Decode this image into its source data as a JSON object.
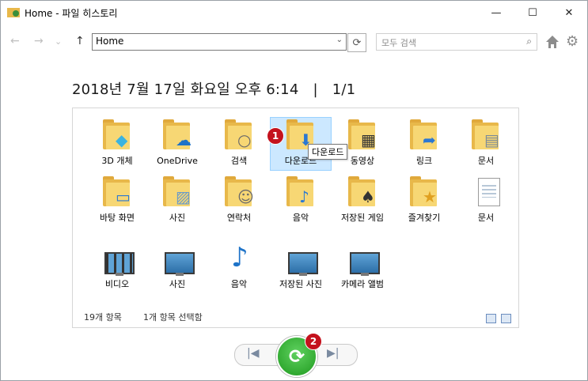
{
  "window": {
    "title": "Home - 파일 히스토리"
  },
  "titlebar": {
    "minimize": "—",
    "maximize": "☐",
    "close": "✕"
  },
  "nav": {
    "back": "←",
    "forward": "→",
    "recent": "⌄",
    "up": "↑",
    "address": "Home",
    "address_dropdown": "⌄",
    "refresh": "⟳",
    "search_placeholder": "모두 검색",
    "search_icon": "⌕",
    "settings_icon": "⚙"
  },
  "header": {
    "date": "2018년 7월 17일 화요일 오후 6:14",
    "separator": "|",
    "page": "1/1"
  },
  "items": [
    {
      "label": "3D 개체",
      "icon": "3d-objects-folder-icon"
    },
    {
      "label": "OneDrive",
      "icon": "onedrive-folder-icon"
    },
    {
      "label": "검색",
      "icon": "search-folder-icon"
    },
    {
      "label": "다운로드",
      "icon": "downloads-folder-icon"
    },
    {
      "label": "동영상",
      "icon": "videos-folder-icon"
    },
    {
      "label": "링크",
      "icon": "links-folder-icon"
    },
    {
      "label": "문서",
      "icon": "documents-folder-icon"
    },
    {
      "label": "바탕 화면",
      "icon": "desktop-folder-icon"
    },
    {
      "label": "사진",
      "icon": "pictures-folder-icon"
    },
    {
      "label": "연락처",
      "icon": "contacts-folder-icon"
    },
    {
      "label": "음악",
      "icon": "music-folder-icon"
    },
    {
      "label": "저장된 게임",
      "icon": "saved-games-folder-icon"
    },
    {
      "label": "즐겨찾기",
      "icon": "favorites-folder-icon"
    },
    {
      "label": "문서",
      "icon": "documents-library-icon"
    },
    {
      "label": "비디오",
      "icon": "videos-library-icon"
    },
    {
      "label": "사진",
      "icon": "pictures-library-icon"
    },
    {
      "label": "음악",
      "icon": "music-library-icon"
    },
    {
      "label": "저장된 사진",
      "icon": "saved-pictures-library-icon"
    },
    {
      "label": "카메라 앨범",
      "icon": "camera-roll-library-icon"
    }
  ],
  "tooltip": "다운로드",
  "status": {
    "count": "19개 항목",
    "selected": "1개 항목 선택함"
  },
  "badges": {
    "one": "1",
    "two": "2"
  },
  "playback": {
    "prev": "|◀",
    "next": "▶|",
    "restore": "⟳"
  },
  "colors": {
    "selection": "#cce8ff",
    "badge": "#c4121d",
    "restore": "#2eaa2e",
    "folder": "#f7d774"
  }
}
